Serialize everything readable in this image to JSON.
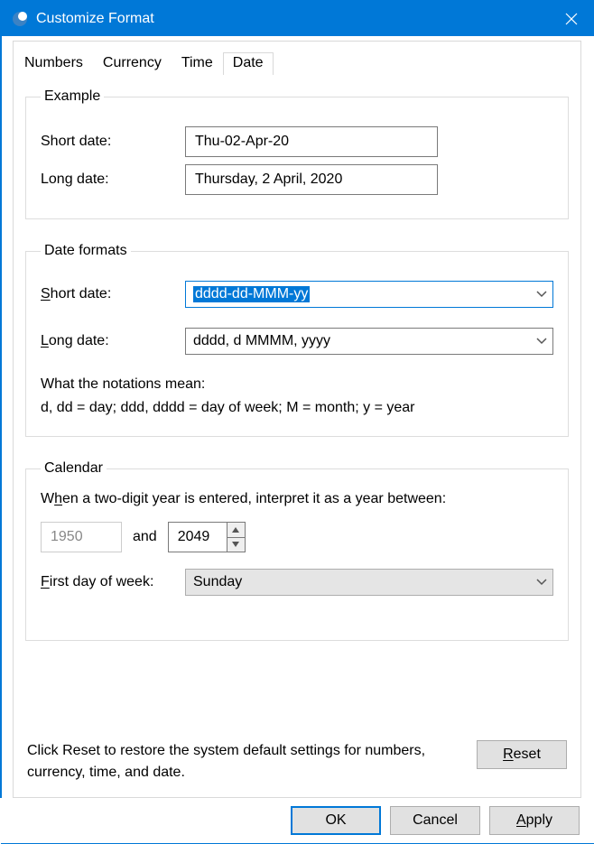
{
  "window": {
    "title": "Customize Format"
  },
  "tabs": [
    "Numbers",
    "Currency",
    "Time",
    "Date"
  ],
  "active_tab_index": 3,
  "example": {
    "legend": "Example",
    "short_label": "Short date:",
    "short_value": "Thu-02-Apr-20",
    "long_label": "Long date:",
    "long_value": "Thursday, 2 April, 2020"
  },
  "formats": {
    "legend": "Date formats",
    "short_label": "Short date:",
    "short_key": "S",
    "short_value": "dddd-dd-MMM-yy",
    "long_label": "Long date:",
    "long_key": "L",
    "long_value": "dddd, d MMMM, yyyy",
    "notations_line1": "What the notations mean:",
    "notations_line2": "d, dd = day;  ddd, dddd = day of week;  M = month;  y = year"
  },
  "calendar": {
    "legend": "Calendar",
    "two_digit_label": "When a two-digit year is entered, interpret it as a year between:",
    "two_digit_key": "h",
    "year_from": "1950",
    "and_label": "and",
    "year_to": "2049",
    "first_day_label": "First day of week:",
    "first_day_key": "F",
    "first_day_value": "Sunday"
  },
  "reset": {
    "text": "Click Reset to restore the system default settings for numbers, currency, time, and date.",
    "button": "Reset",
    "key": "R"
  },
  "buttons": {
    "ok": "OK",
    "cancel": "Cancel",
    "apply": "Apply",
    "apply_key": "A"
  }
}
